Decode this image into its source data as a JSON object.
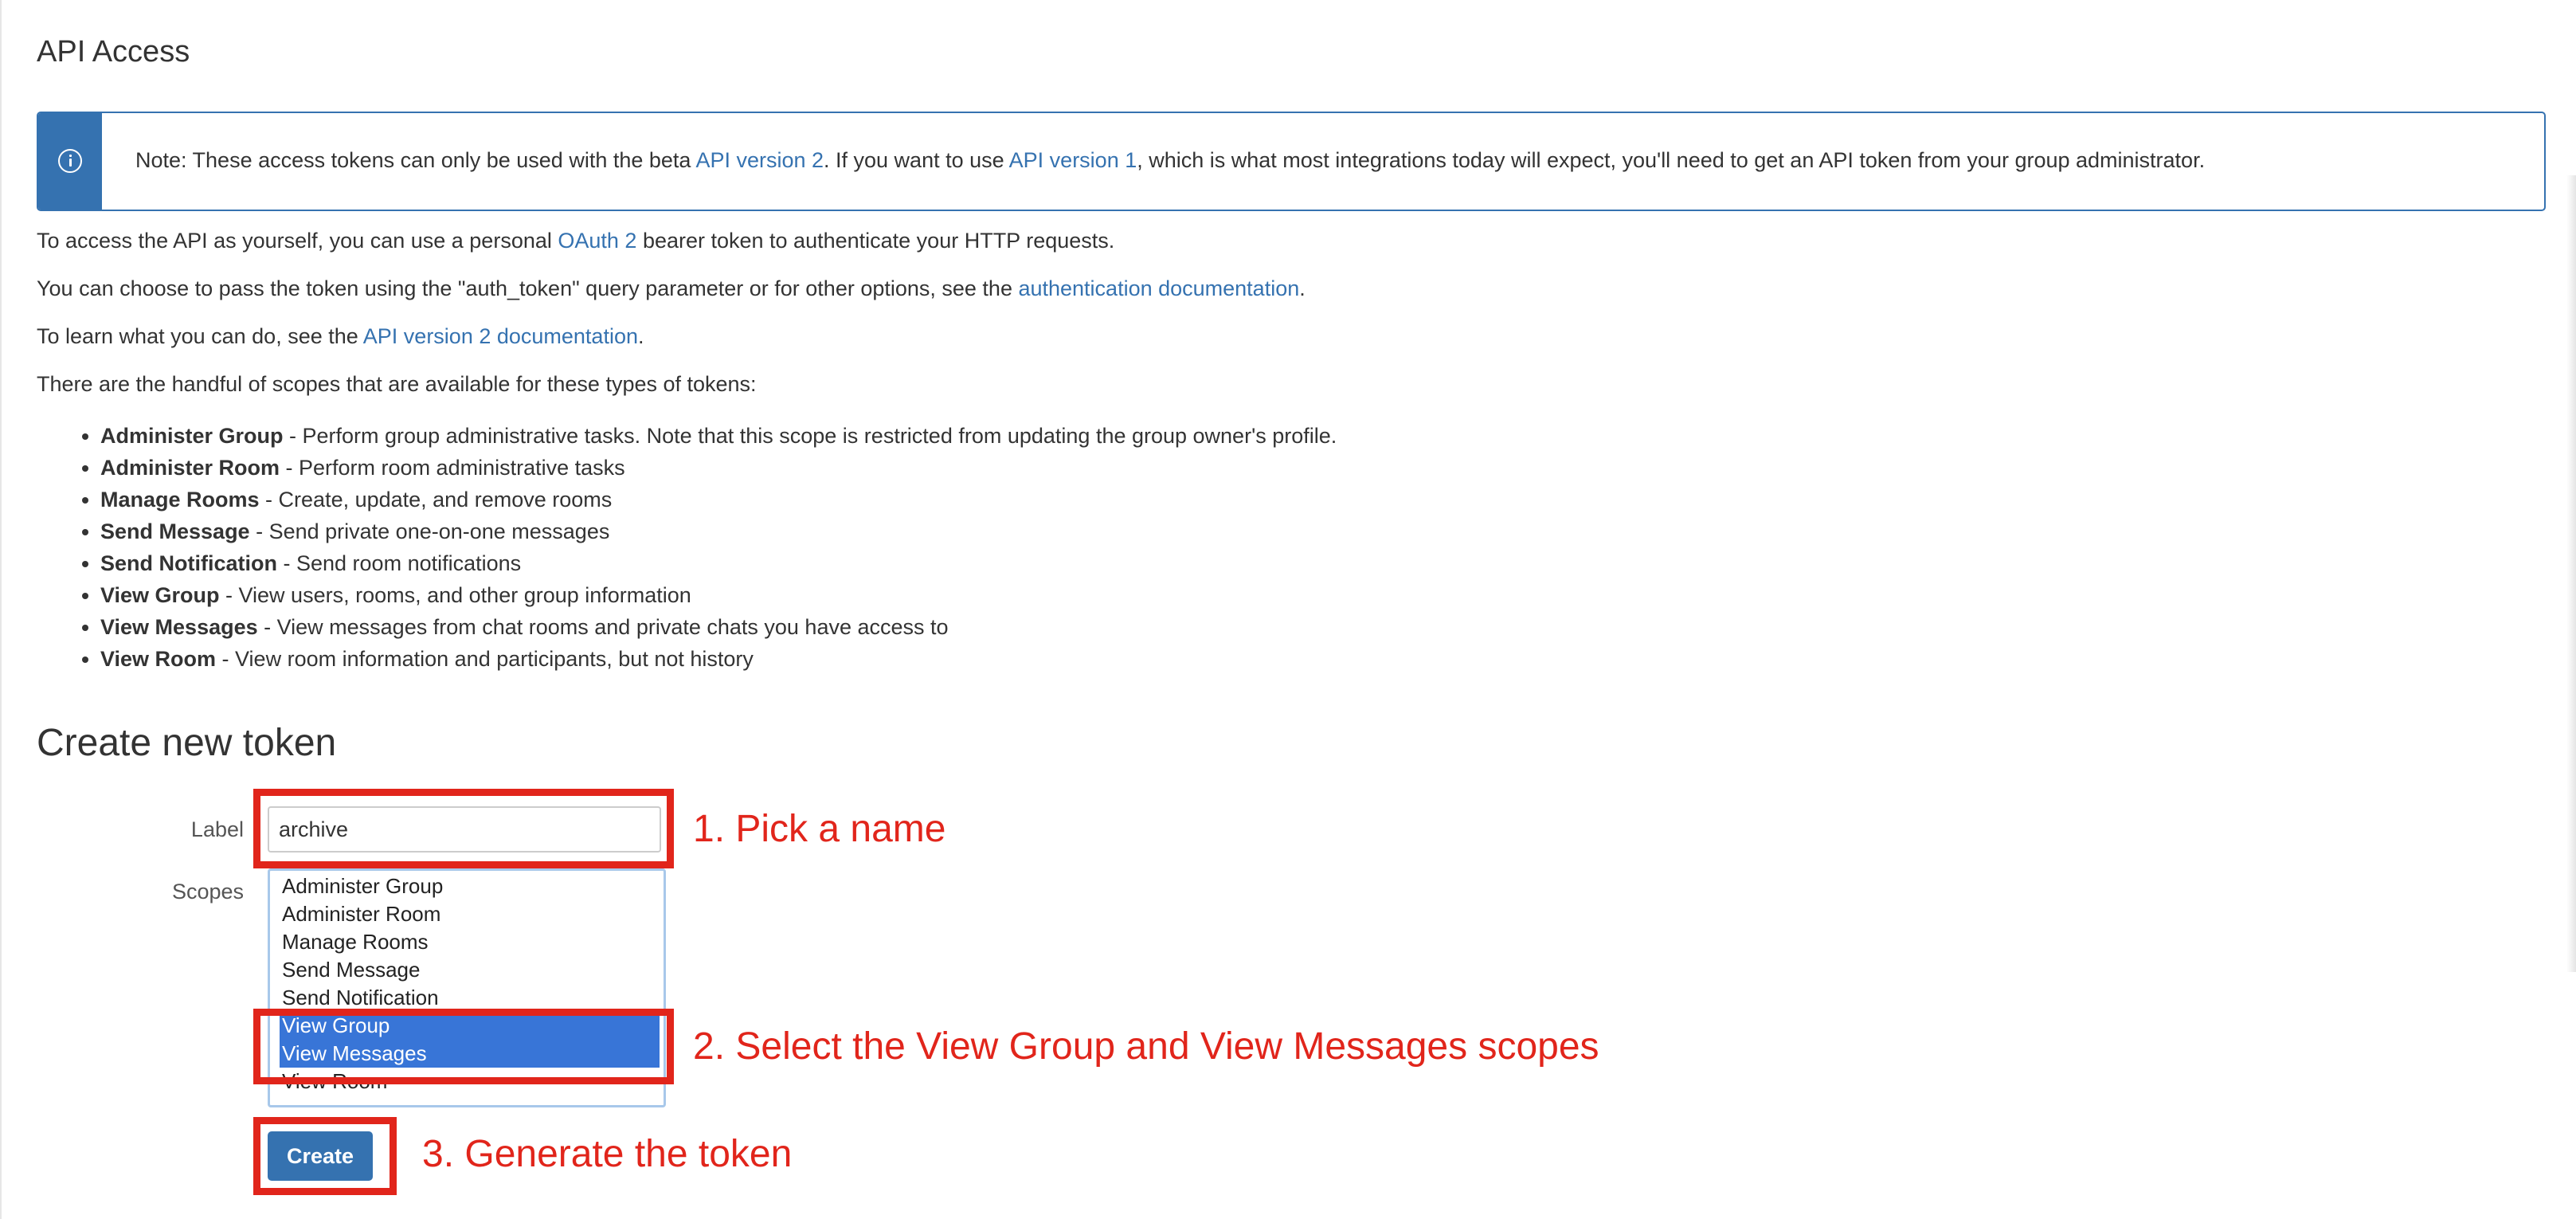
{
  "page": {
    "title": "API Access"
  },
  "note": {
    "part1": "Note: These access tokens can only be used with the beta ",
    "link1": "API version 2",
    "part2": ". If you want to use ",
    "link2": "API version 1",
    "part3": ", which is what most integrations today will expect, you'll need to get an API token from your group administrator."
  },
  "intro": {
    "p1_before": "To access the API as yourself, you can use a personal ",
    "p1_link": "OAuth 2",
    "p1_after": " bearer token to authenticate your HTTP requests.",
    "p2_before": "You can choose to pass the token using the \"auth_token\" query parameter or for other options, see the ",
    "p2_link": "authentication documentation",
    "p2_after": ".",
    "p3_before": "To learn what you can do, see the ",
    "p3_link": "API version 2 documentation",
    "p3_after": ".",
    "p4": "There are the handful of scopes that are available for these types of tokens:"
  },
  "scopes_list": [
    {
      "name": "Administer Group",
      "desc": " - Perform group administrative tasks. Note that this scope is restricted from updating the group owner's profile."
    },
    {
      "name": "Administer Room",
      "desc": " - Perform room administrative tasks"
    },
    {
      "name": "Manage Rooms",
      "desc": " - Create, update, and remove rooms"
    },
    {
      "name": "Send Message",
      "desc": " - Send private one-on-one messages"
    },
    {
      "name": "Send Notification",
      "desc": " - Send room notifications"
    },
    {
      "name": "View Group",
      "desc": " - View users, rooms, and other group information"
    },
    {
      "name": "View Messages",
      "desc": " - View messages from chat rooms and private chats you have access to"
    },
    {
      "name": "View Room",
      "desc": " - View room information and participants, but not history"
    }
  ],
  "form": {
    "section_title": "Create new token",
    "label_caption": "Label",
    "label_value": "archive",
    "scopes_caption": "Scopes",
    "options": [
      {
        "text": "Administer Group",
        "selected": false
      },
      {
        "text": "Administer Room",
        "selected": false
      },
      {
        "text": "Manage Rooms",
        "selected": false
      },
      {
        "text": "Send Message",
        "selected": false
      },
      {
        "text": "Send Notification",
        "selected": false
      },
      {
        "text": "View Group",
        "selected": true
      },
      {
        "text": "View Messages",
        "selected": true
      },
      {
        "text": "View Room",
        "selected": false
      }
    ],
    "create_label": "Create"
  },
  "annotations": {
    "step1": "1. Pick a name",
    "step2": "2. Select the View Group and View Messages scopes",
    "step3": "3. Generate the token"
  },
  "colors": {
    "accent": "#3572b0",
    "selection": "#3875d7",
    "annotation": "#e1251b"
  }
}
